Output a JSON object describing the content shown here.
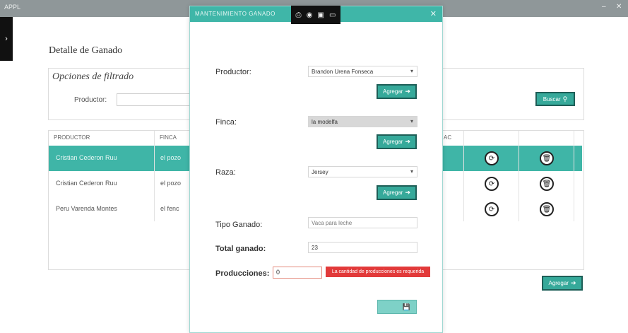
{
  "window": {
    "app_label": "APPL",
    "minimize": "–",
    "close": "✕"
  },
  "sidebar_toggle": "›",
  "page": {
    "title": "Detalle de Ganado",
    "filter": {
      "title": "Opciones de filtrado",
      "productor_label": "Productor:",
      "search_button": "Buscar"
    },
    "table": {
      "headers": [
        "PRODUCTOR",
        "FINCA",
        "AC"
      ],
      "rows": [
        {
          "productor": "Cristian Cederon Ruu",
          "finca": "el pozo"
        },
        {
          "productor": "Cristian Cederon Ruu",
          "finca": "el pozo"
        },
        {
          "productor": "Peru Varenda Montes",
          "finca": "el fenc"
        }
      ]
    },
    "add_button": "Agregar"
  },
  "modal": {
    "title": "MANTENIMIENTO GANADO",
    "close": "✕",
    "productor": {
      "label": "Productor:",
      "value": "Brandon Urena Fonseca"
    },
    "finca": {
      "label": "Finca:",
      "value": "la modelfa"
    },
    "raza": {
      "label": "Raza:",
      "value": "Jersey"
    },
    "agregar_label": "Agregar",
    "tipo_ganado": {
      "label": "Tipo Ganado:",
      "placeholder": "Vaca para leche"
    },
    "total_ganado": {
      "label": "Total ganado:",
      "value": "23"
    },
    "producciones": {
      "label": "Producciones:",
      "value": "0",
      "error": "La cantidad de producciones es requerida"
    },
    "save_icon": "💾"
  },
  "colors": {
    "accent": "#3fb6a8",
    "error": "#e23a3a"
  }
}
